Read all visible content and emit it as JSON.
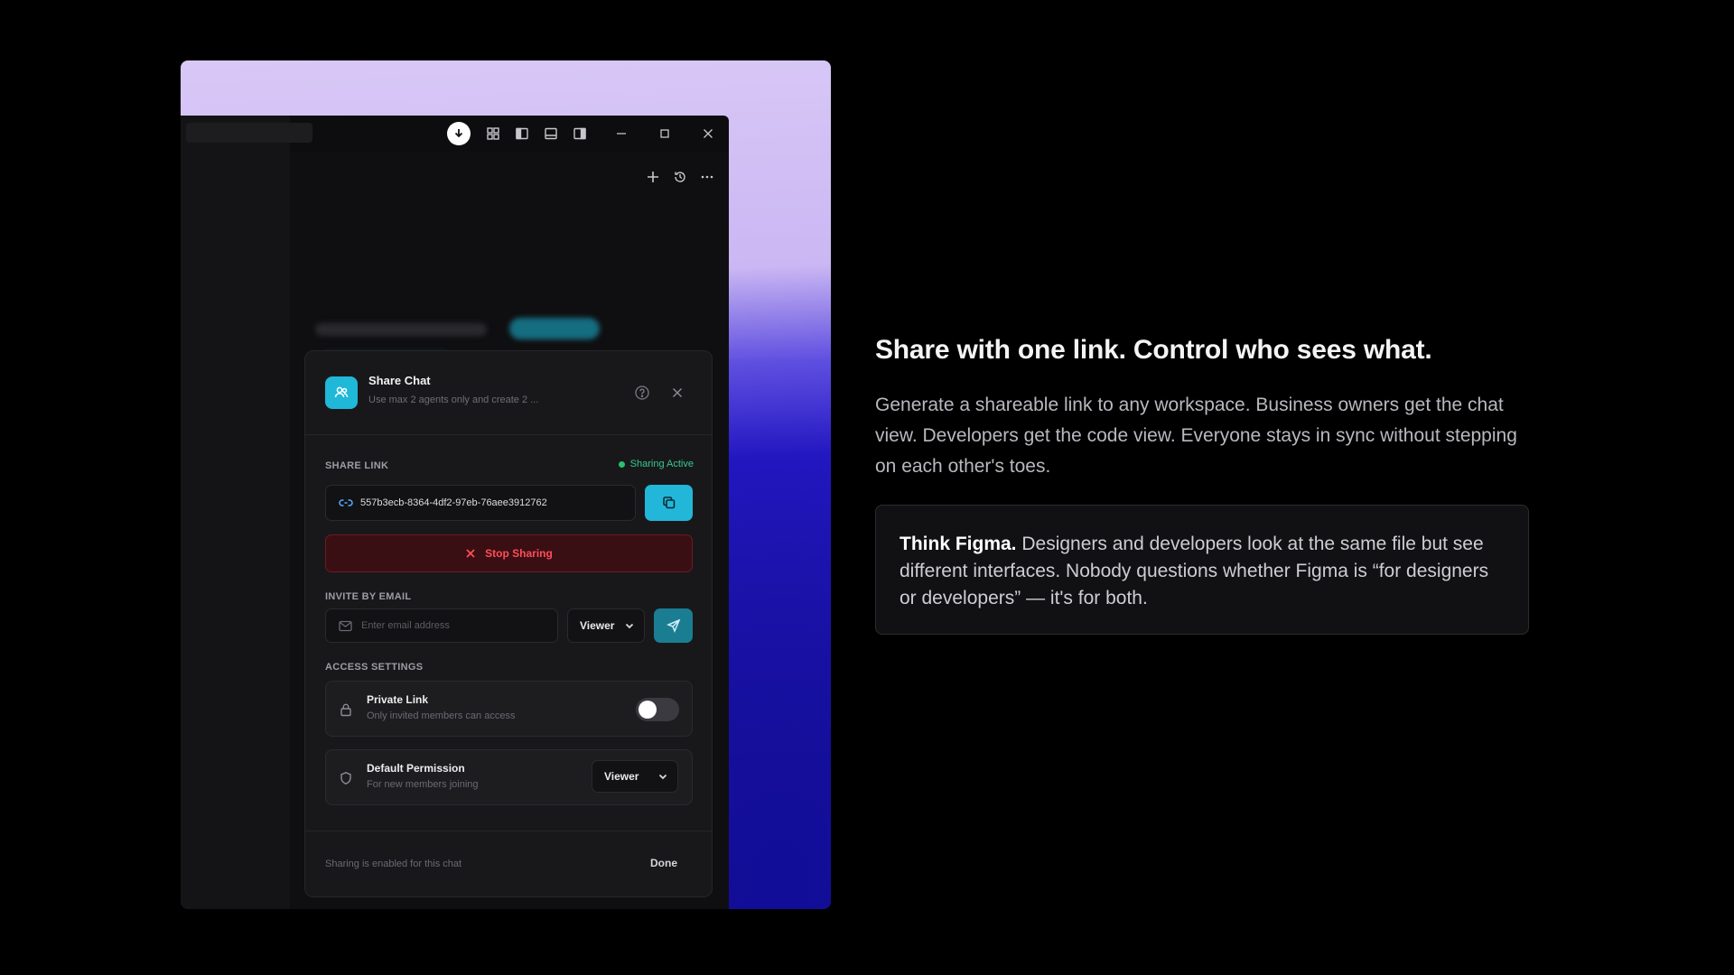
{
  "dialog": {
    "title": "Share Chat",
    "subtitle": "Use max 2 agents only and create 2 ...",
    "share_link_label": "SHARE LINK",
    "sharing_status": "Sharing Active",
    "link_value": "557b3ecb-8364-4df2-97eb-76aee3912762",
    "stop_sharing_label": "Stop Sharing",
    "invite_label": "INVITE BY EMAIL",
    "email_placeholder": "Enter email address",
    "invite_role": "Viewer",
    "access_label": "ACCESS SETTINGS",
    "private_link_title": "Private Link",
    "private_link_sub": "Only invited members can access",
    "private_link_enabled": false,
    "default_perm_title": "Default Permission",
    "default_perm_sub": "For new members joining",
    "default_perm_value": "Viewer",
    "footer_text": "Sharing is enabled for this chat",
    "done_label": "Done"
  },
  "colors": {
    "accent": "#22b7d8",
    "status_green": "#23c46f",
    "danger": "#ff4d5a"
  },
  "copy": {
    "headline": "Share with one link. Control who sees what.",
    "body": "Generate a shareable link to any workspace. Business owners get the chat view. Developers get the code view. Everyone stays in sync without stepping on each other's toes.",
    "quote_lead": "Think Figma.",
    "quote_body": " Designers and developers look at the same file but see different interfaces. Nobody questions whether Figma is “for designers or developers” — it's for both."
  }
}
